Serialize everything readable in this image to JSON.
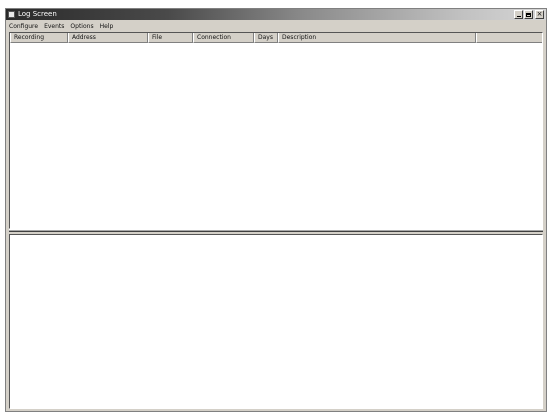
{
  "window": {
    "title": "Log Screen",
    "controls": {
      "minimize": "_",
      "maximize": "□",
      "close": "×"
    }
  },
  "menu": [
    "Configure",
    "Events",
    "Options",
    "Help"
  ],
  "columns": [
    "Recording",
    "Address",
    "File",
    "Connection",
    "Days",
    "Description"
  ],
  "icons": {
    "app": "app-icon"
  }
}
